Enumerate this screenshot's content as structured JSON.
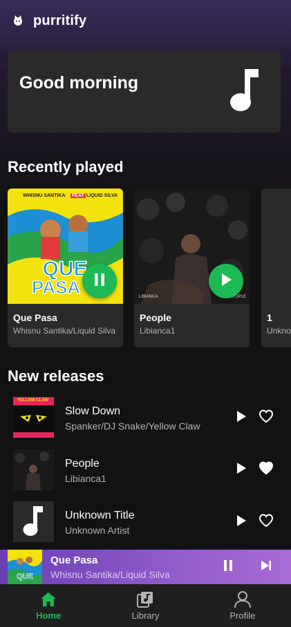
{
  "app": {
    "title": "purritify"
  },
  "greeting": {
    "text": "Good morning",
    "icon": "music-note-icon"
  },
  "recently_played": {
    "heading": "Recently played",
    "items": [
      {
        "title": "Que Pasa",
        "artist": "Whisnu Santika/Liquid Silva",
        "cover_text_top": "WHISNU SANTIKA",
        "cover_text_feat": "FEAT",
        "cover_text_top2": "LIQUID SILVA",
        "state": "playing",
        "action_icon": "pause-icon"
      },
      {
        "title": "People",
        "artist": "Libianca1",
        "cover_text_left": "LIBIANCA",
        "cover_text_right": "PEOPLE",
        "state": "paused",
        "action_icon": "play-icon"
      },
      {
        "title": "1",
        "artist": "Unknown Artist",
        "state": "none"
      }
    ]
  },
  "new_releases": {
    "heading": "New releases",
    "items": [
      {
        "title": "Slow Down",
        "artist": "Spanker/DJ Snake/Yellow Claw",
        "cover_text": "YELLOW CLAW",
        "liked": false
      },
      {
        "title": "People",
        "artist": "Libianca1",
        "liked": true
      },
      {
        "title": "Unknown Title",
        "artist": "Unknown Artist",
        "liked": false
      }
    ]
  },
  "now_playing": {
    "title": "Que Pasa",
    "artist": "Whisnu Santika/Liquid Silva",
    "state": "playing"
  },
  "nav": [
    {
      "label": "Home",
      "icon": "home-icon",
      "active": true
    },
    {
      "label": "Library",
      "icon": "library-icon",
      "active": false
    },
    {
      "label": "Profile",
      "icon": "profile-icon",
      "active": false
    }
  ],
  "colors": {
    "accent": "#1db954",
    "background": "#121212",
    "card": "#2a2a2a",
    "mini_player": "#8e5ac9"
  }
}
